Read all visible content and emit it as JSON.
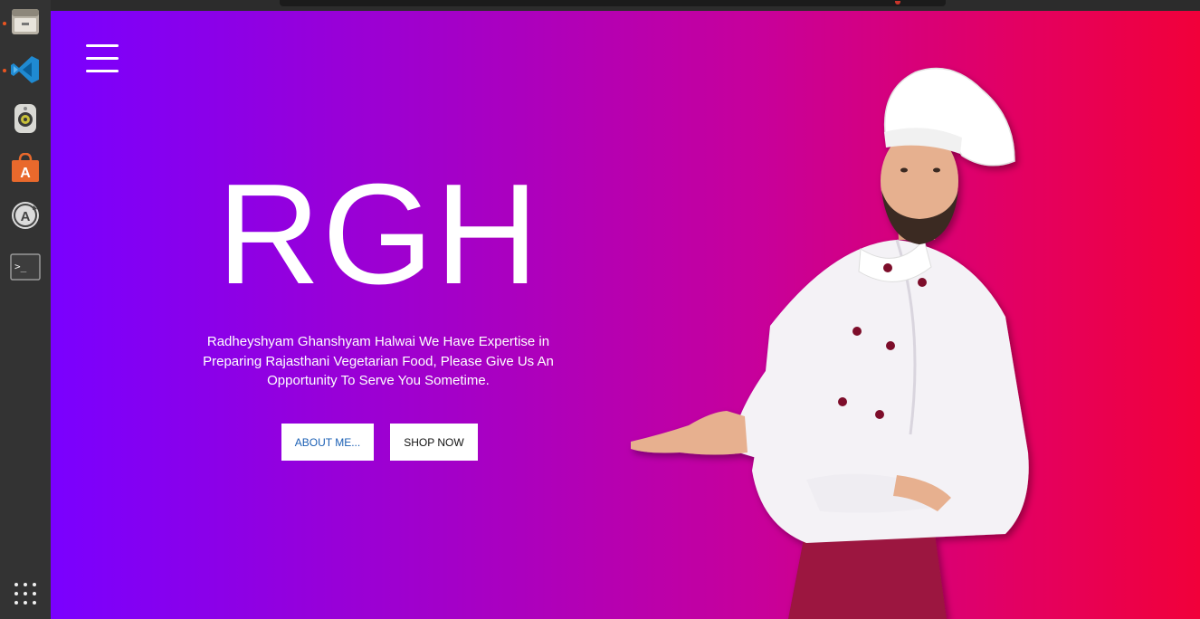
{
  "dock": {
    "items": [
      {
        "icon": "file-manager-icon",
        "running": true
      },
      {
        "icon": "vscode-icon",
        "running": true
      },
      {
        "icon": "speaker-icon",
        "running": false
      },
      {
        "icon": "software-store-icon",
        "running": false
      },
      {
        "icon": "software-updater-icon",
        "running": false
      },
      {
        "icon": "terminal-icon",
        "running": false
      }
    ],
    "apps_grid_icon": "show-apps-icon"
  },
  "hero": {
    "menu_icon": "hamburger-menu-icon",
    "brand": "RGH",
    "tagline_lines": [
      "Radheyshyam Ghanshyam Halwai We Have Expertise in",
      "Preparing Rajasthani Vegetarian Food, Please Give Us An",
      "Opportunity To Serve You Sometime."
    ],
    "about_button": "ABOUT ME...",
    "shop_button": "SHOP NOW",
    "image": "chef-illustration"
  },
  "colors": {
    "gradient_start": "#7a00ff",
    "gradient_end": "#f1003a",
    "about_text": "#1a5fb4",
    "dock_bg": "#333333",
    "running_indicator": "#e95420"
  }
}
